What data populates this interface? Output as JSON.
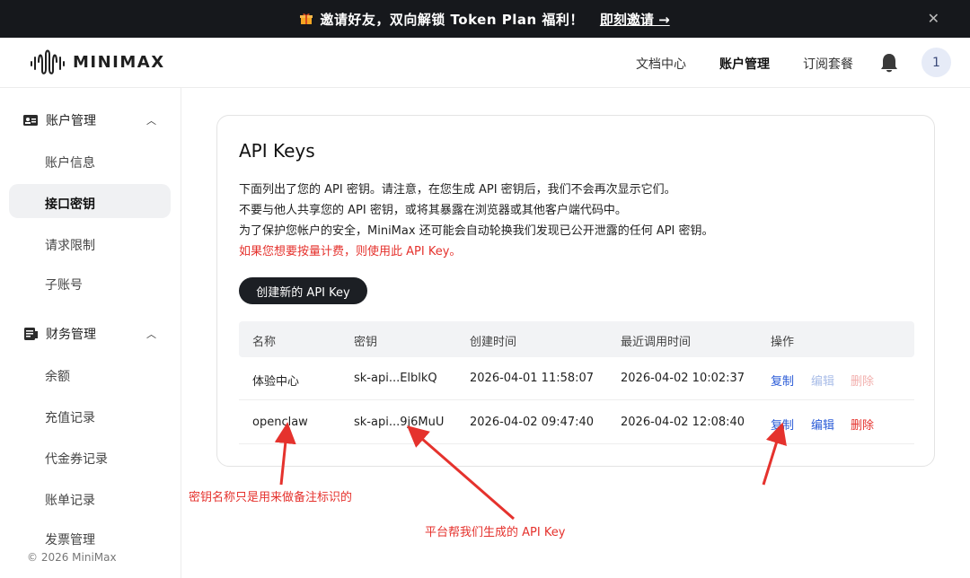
{
  "banner": {
    "text": "邀请好友，双向解锁 Token Plan 福利！",
    "link": "即刻邀请 →"
  },
  "header": {
    "logo_text": "MINIMAX",
    "nav": [
      "文档中心",
      "账户管理",
      "订阅套餐"
    ],
    "avatar_label": "1"
  },
  "sidebar": {
    "groups": [
      {
        "label": "账户管理",
        "items": [
          "账户信息",
          "接口密钥",
          "请求限制",
          "子账号"
        ]
      },
      {
        "label": "财务管理",
        "items": [
          "余额",
          "充值记录",
          "代金券记录",
          "账单记录",
          "发票管理"
        ]
      }
    ],
    "active_item": "接口密钥",
    "copyright": "© 2026 MiniMax"
  },
  "main": {
    "title": "API Keys",
    "description": [
      "下面列出了您的 API 密钥。请注意，在您生成 API 密钥后，我们不会再次显示它们。",
      "不要与他人共享您的 API 密钥，或将其暴露在浏览器或其他客户端代码中。",
      "为了保护您帐户的安全，MiniMax 还可能会自动轮换我们发现已公开泄露的任何 API 密钥。"
    ],
    "notice": "如果您想要按量计费，则使用此 API Key。",
    "create_button": "创建新的 API Key",
    "table": {
      "headers": [
        "名称",
        "密钥",
        "创建时间",
        "最近调用时间",
        "操作"
      ],
      "rows": [
        {
          "name": "体验中心",
          "key": "sk-api...ElblkQ",
          "created": "2026-04-01 11:58:07",
          "last_used": "2026-04-02 10:02:37",
          "actions": [
            "复制",
            "编辑",
            "删除"
          ]
        },
        {
          "name": "openclaw",
          "key": "sk-api...9j6MuU",
          "created": "2026-04-02 09:47:40",
          "last_used": "2026-04-02 12:08:40",
          "actions": [
            "复制",
            "编辑",
            "删除"
          ]
        }
      ]
    }
  },
  "annotations": {
    "name_note": "密钥名称只是用来做备注标识的",
    "key_note": "平台帮我们生成的 API Key"
  },
  "colors": {
    "banner_bg": "#16181c",
    "accent_blue": "#2a5bd7",
    "danger_red": "#e5322d",
    "button_dark": "#1c1f24"
  }
}
